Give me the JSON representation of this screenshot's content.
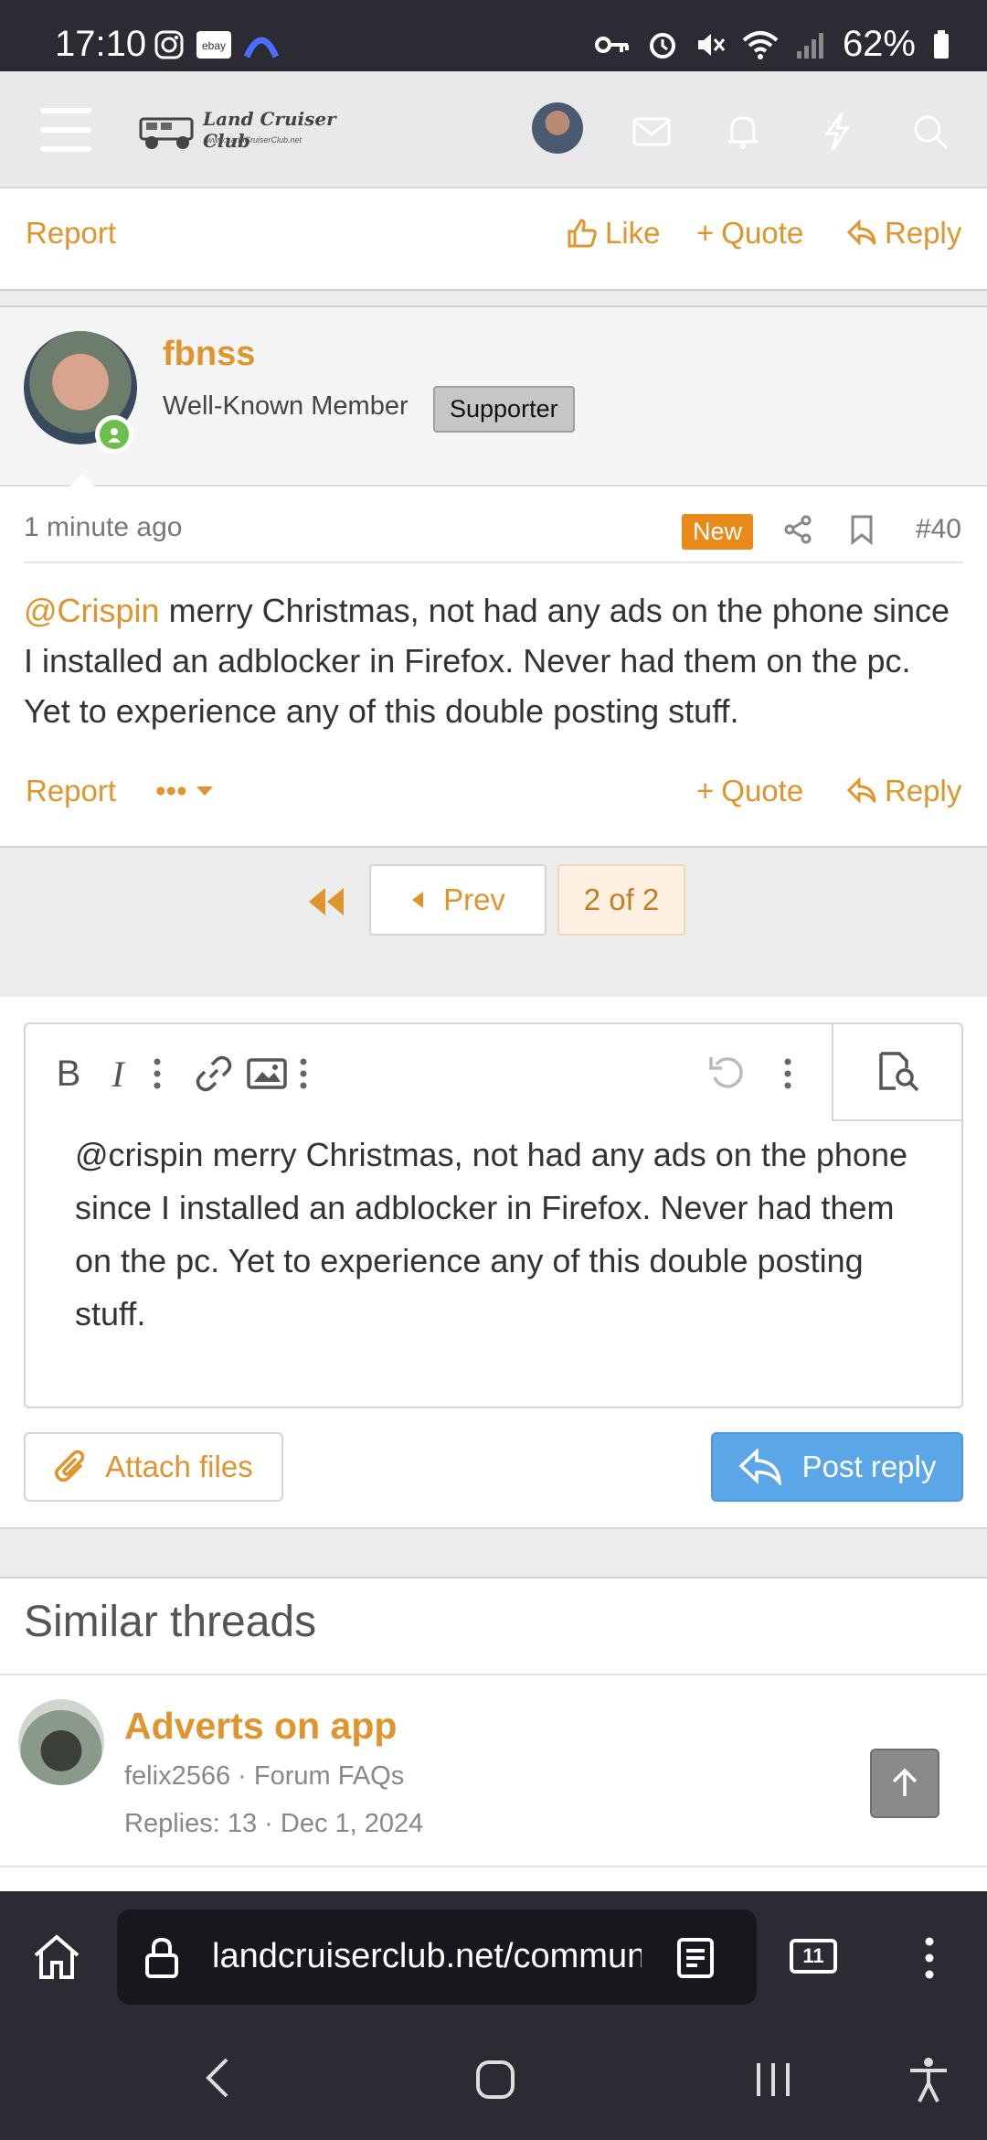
{
  "status_bar": {
    "time": "17:10",
    "battery": "62%"
  },
  "header": {
    "logo_title": "Land Cruiser Club",
    "logo_subtitle": "www.LandCruiserClub.net"
  },
  "prev_post_actions": {
    "report": "Report",
    "like": "Like",
    "quote": "Quote",
    "reply": "Reply"
  },
  "post": {
    "username": "fbnss",
    "user_title": "Well-Known Member",
    "user_badge": "Supporter",
    "time": "1 minute ago",
    "new_label": "New",
    "number": "#40",
    "mention": "@Crispin",
    "body": " merry Christmas, not had any ads on the phone since I installed an adblocker in Firefox. Never had them on the pc. Yet to experience any of this double posting stuff.",
    "actions": {
      "report": "Report",
      "more": "•••",
      "quote": "Quote",
      "reply": "Reply"
    }
  },
  "pagination": {
    "prev": "Prev",
    "current": "2 of 2"
  },
  "editor": {
    "text": "@crispin merry Christmas, not had any ads on the phone since I installed an adblocker in Firefox. Never had them on the pc. Yet to experience any of this double posting stuff.",
    "attach_label": "Attach files",
    "post_reply_label": "Post reply"
  },
  "similar": {
    "heading": "Similar threads",
    "threads": [
      {
        "title": "Adverts on app",
        "author": "felix2566",
        "forum": "Forum FAQs",
        "replies": "Replies: 13",
        "date": "Dec 1, 2024"
      }
    ]
  },
  "browser": {
    "url": "landcruiserclub.net/community/threads",
    "tab_count": "11"
  }
}
